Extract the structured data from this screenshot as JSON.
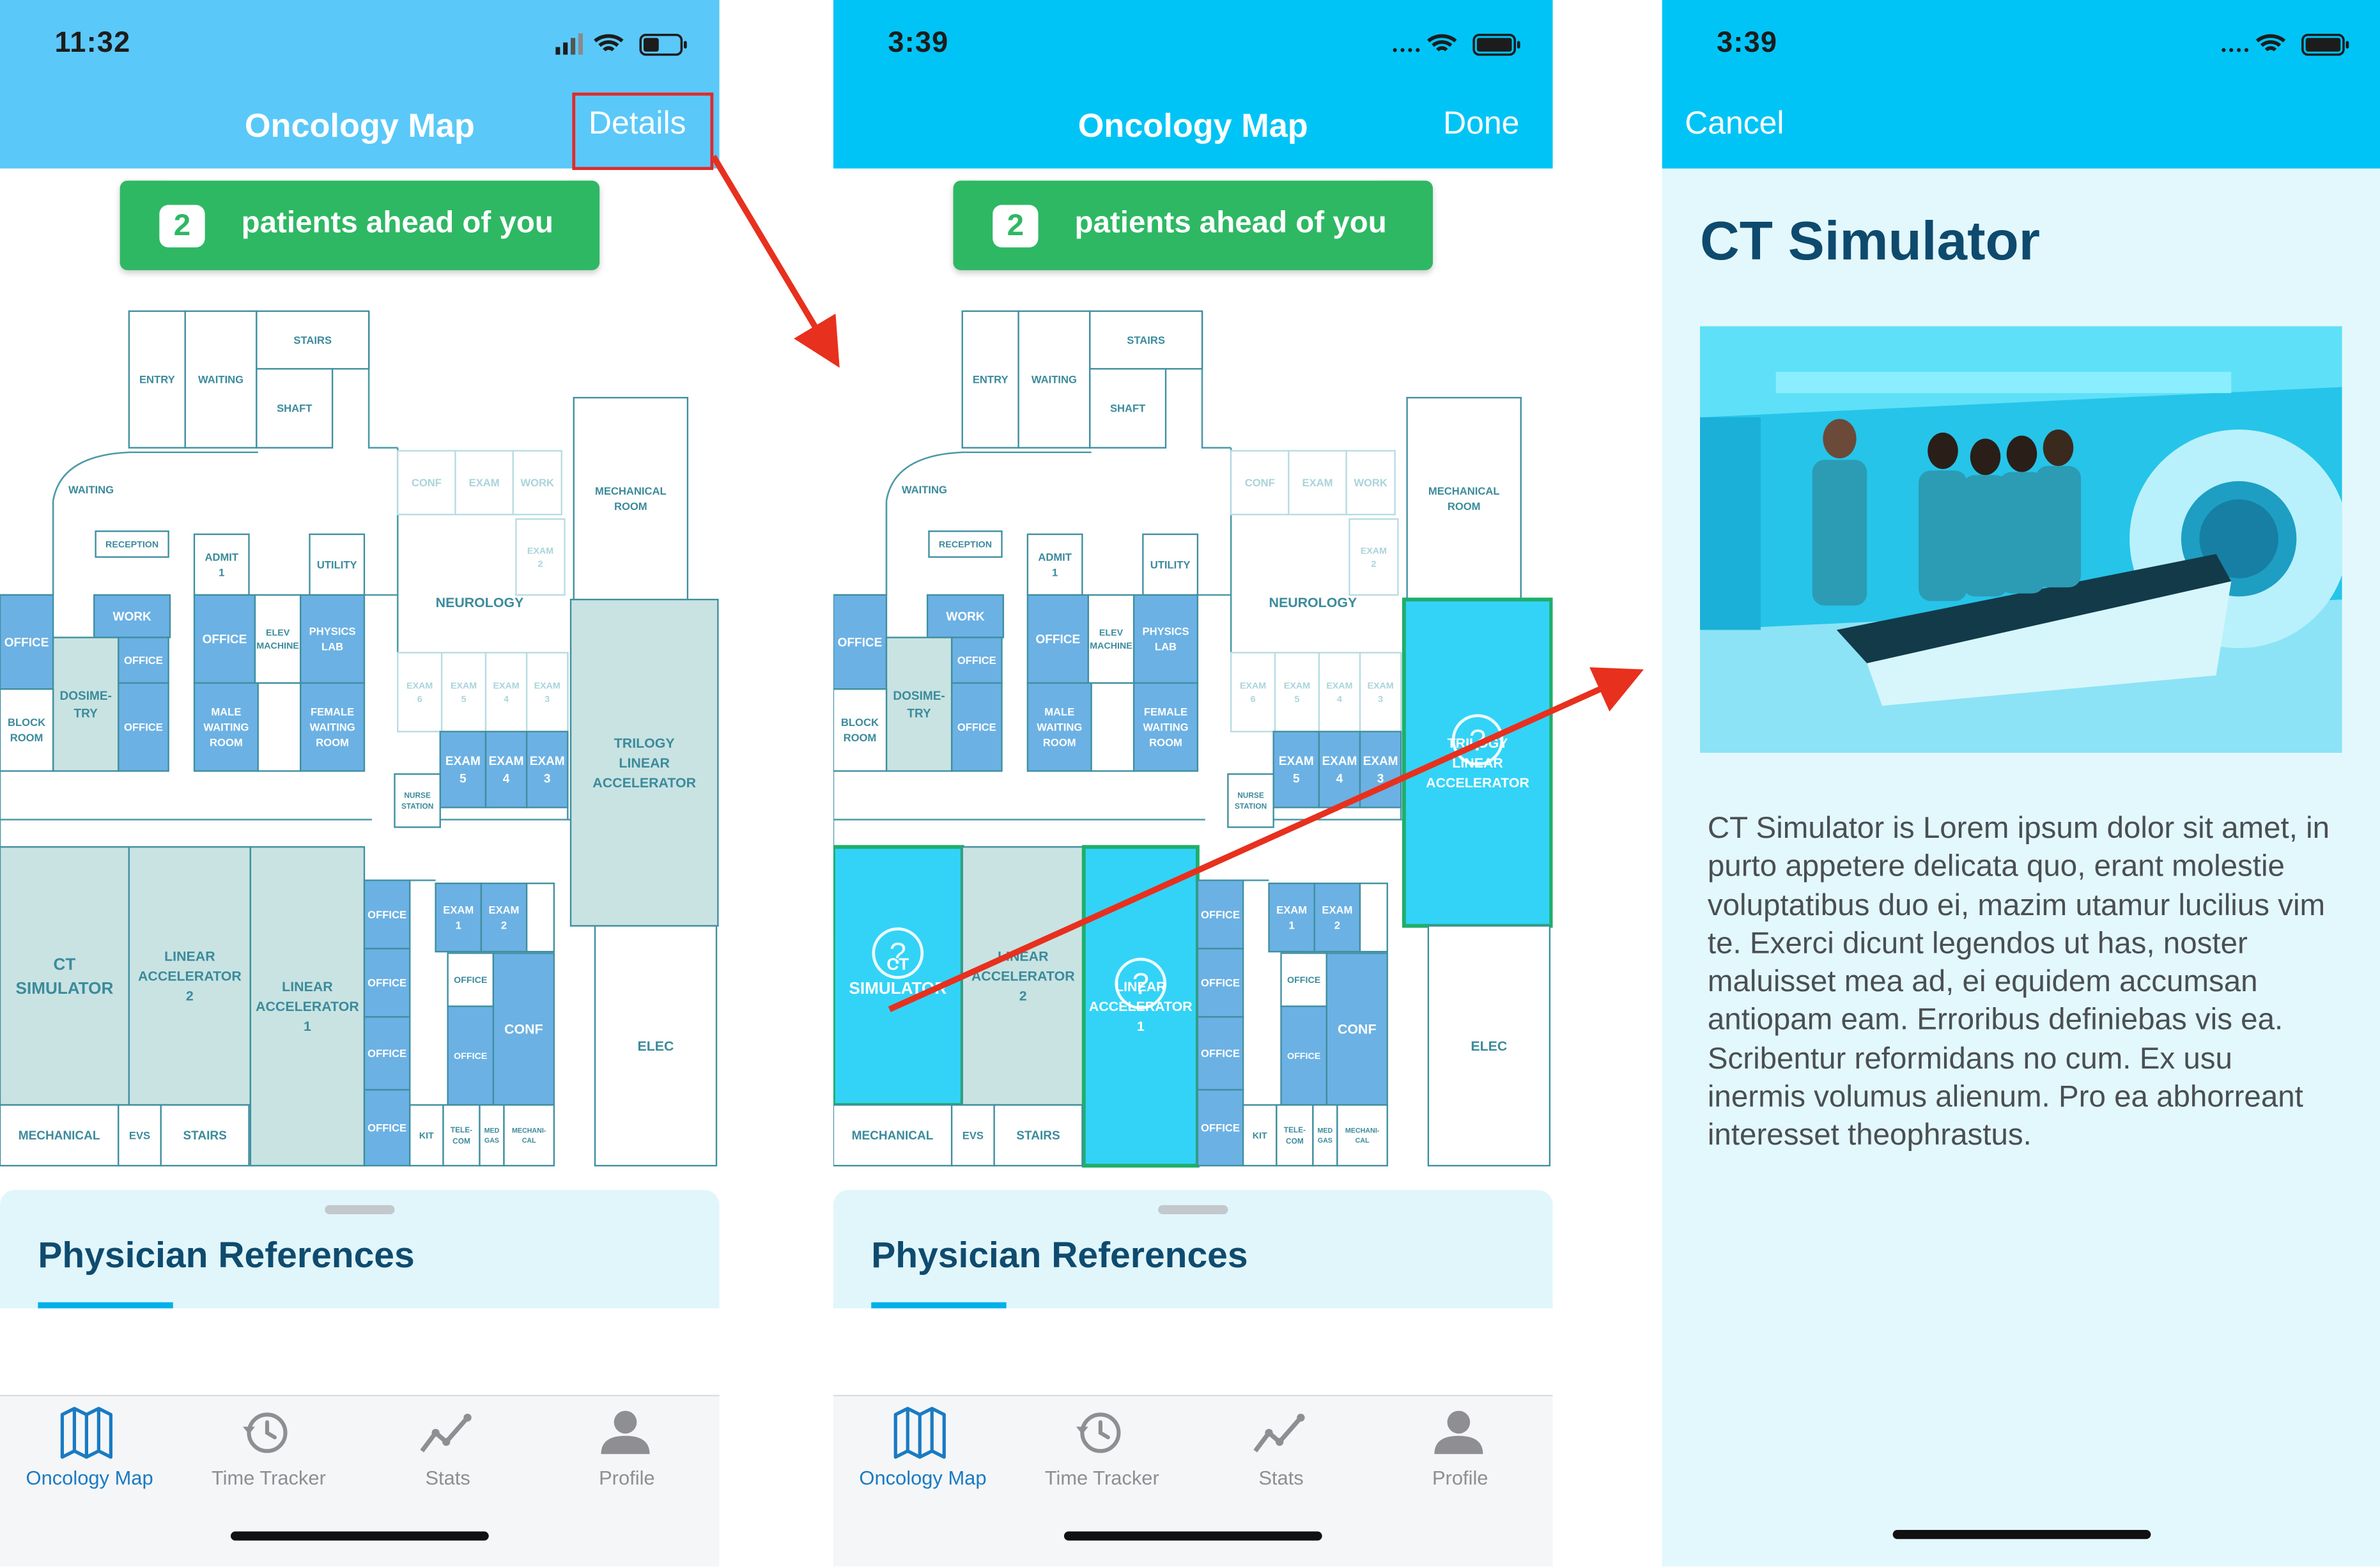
{
  "screens": [
    {
      "status_time": "11:32",
      "nav_title": "Oncology Map",
      "nav_right": "Details",
      "queue_count": "2",
      "queue_text": "patients ahead of you",
      "sheet_title": "Physician References"
    },
    {
      "status_time": "3:39",
      "nav_title": "Oncology Map",
      "nav_right": "Done",
      "queue_count": "2",
      "queue_text": "patients ahead of you",
      "sheet_title": "Physician References",
      "highlighted_rooms": [
        "CT SIMULATOR",
        "LINEAR ACCELERATOR 1",
        "TRILOGY LINEAR ACCELERATOR"
      ]
    },
    {
      "status_time": "3:39",
      "nav_left": "Cancel",
      "title": "CT Simulator",
      "description": "CT Simulator is Lorem ipsum dolor sit amet, in purto appetere delicata quo, erant molestie voluptatibus duo ei, mazim utamur lucilius vim te. Exerci dicunt legendos ut has, noster maluisset mea ad, ei equidem accumsan antiopam eam. Erroribus definiebas vis ea. Scribentur reformidans no cum. Ex usu inermis volumus alienum. Pro ea abhorreant interesset theophrastus."
    }
  ],
  "tabs": [
    {
      "label": "Oncology Map",
      "icon": "map-icon"
    },
    {
      "label": "Time Tracker",
      "icon": "history-clock-icon"
    },
    {
      "label": "Stats",
      "icon": "trend-line-icon"
    },
    {
      "label": "Profile",
      "icon": "person-icon"
    }
  ],
  "rooms": {
    "entry": "ENTRY",
    "waiting": "WAITING",
    "stairs": "STAIRS",
    "shaft": "SHAFT",
    "conf": "CONF",
    "exam": "EXAM",
    "work": "WORK",
    "mechanical": "MECHANICAL",
    "room": "ROOM",
    "reception": "RECEPTION",
    "admit": "ADMIT",
    "utility": "UTILITY",
    "neurology": "NEUROLOGY",
    "office": "OFFICE",
    "elev": "ELEV",
    "machine": "MACHINE",
    "physics": "PHYSICS",
    "lab": "LAB",
    "block": "BLOCK",
    "dosime": "DOSIME-",
    "try": "TRY",
    "male": "MALE",
    "female": "FEMALE",
    "trilogy": "TRILOGY",
    "linear": "LINEAR",
    "accelerator": "ACCELERATOR",
    "nurse": "NURSE",
    "station": "STATION",
    "ct": "CT",
    "simulator": "SIMULATOR",
    "evs": "EVS",
    "kit": "KIT",
    "tele": "TELE-",
    "com": "COM",
    "med": "MED",
    "gas": "GAS",
    "mechani": "MECHANI-",
    "cal": "CAL",
    "elec": "ELEC",
    "n1": "1",
    "n2": "2",
    "n3": "3",
    "n4": "4",
    "n5": "5",
    "n6": "6"
  },
  "colors": {
    "navbar": "#5ac8f8",
    "navbar_alt": "#00c4f5",
    "queue_green": "#2fb864",
    "room_blue": "#6cb1e4",
    "room_teal": "#c8e3e2",
    "highlight": "#33d3f7",
    "highlight_border": "#1fae6c",
    "arrow": "#e8301f"
  }
}
